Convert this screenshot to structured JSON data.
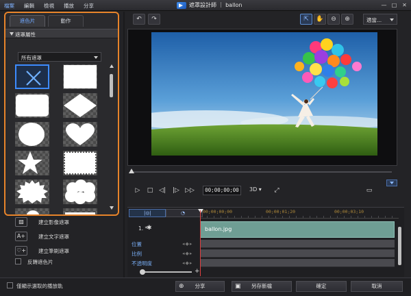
{
  "menu": {
    "items": [
      "檔案",
      "編輯",
      "檢視",
      "播放",
      "分享"
    ],
    "active_index": 0
  },
  "window": {
    "title": "遮罩設計師 ｜ ballon",
    "minimize": "—",
    "maximize": "□",
    "close": "✕"
  },
  "left_panel": {
    "tabs": [
      {
        "label": "遮色片",
        "active": true
      },
      {
        "label": "動作",
        "active": false
      }
    ],
    "section_title": "遮罩屬性",
    "dropdown_value": "所有遮罩",
    "masks": [
      "none",
      "rectangle",
      "rounded-rectangle",
      "diamond",
      "circle",
      "heart",
      "star",
      "stamp",
      "burst",
      "cloud",
      "speech-cloud",
      "banner"
    ],
    "selected_mask": "none"
  },
  "actions": [
    {
      "icon": "image-mask-icon",
      "glyph": "▨",
      "label": "建立影像遮罩"
    },
    {
      "icon": "text-mask-icon",
      "glyph": "A+",
      "label": "建立文字遮罩"
    },
    {
      "icon": "brush-mask-icon",
      "glyph": "♡+",
      "label": "建立筆刷遮罩"
    }
  ],
  "invert_mask_label": "反轉遮色片",
  "preview_toolbar": {
    "undo": "↶",
    "redo": "↷",
    "zoom_value": "適當..."
  },
  "transport": {
    "timecode": "00;00;00;00",
    "mode_3d": "3D ▾"
  },
  "timeline": {
    "ruler_ticks": [
      "00;00;00;00",
      "00;00;01;20",
      "00;00;03;10"
    ],
    "track_label": "1. *",
    "clip_name": "ballon.jpg",
    "keyframe_rows": [
      "位置",
      "比例",
      "不透明度"
    ]
  },
  "bottom_bar": {
    "show_selected_track_label": "僅顯示選取的播放軌",
    "share_label": "分享",
    "save_as_label": "另存新檔",
    "ok_label": "確定",
    "cancel_label": "取消"
  },
  "colors": {
    "accent_orange": "#e8842a",
    "accent_blue": "#3d8bff",
    "clip": "#6f9e94"
  }
}
